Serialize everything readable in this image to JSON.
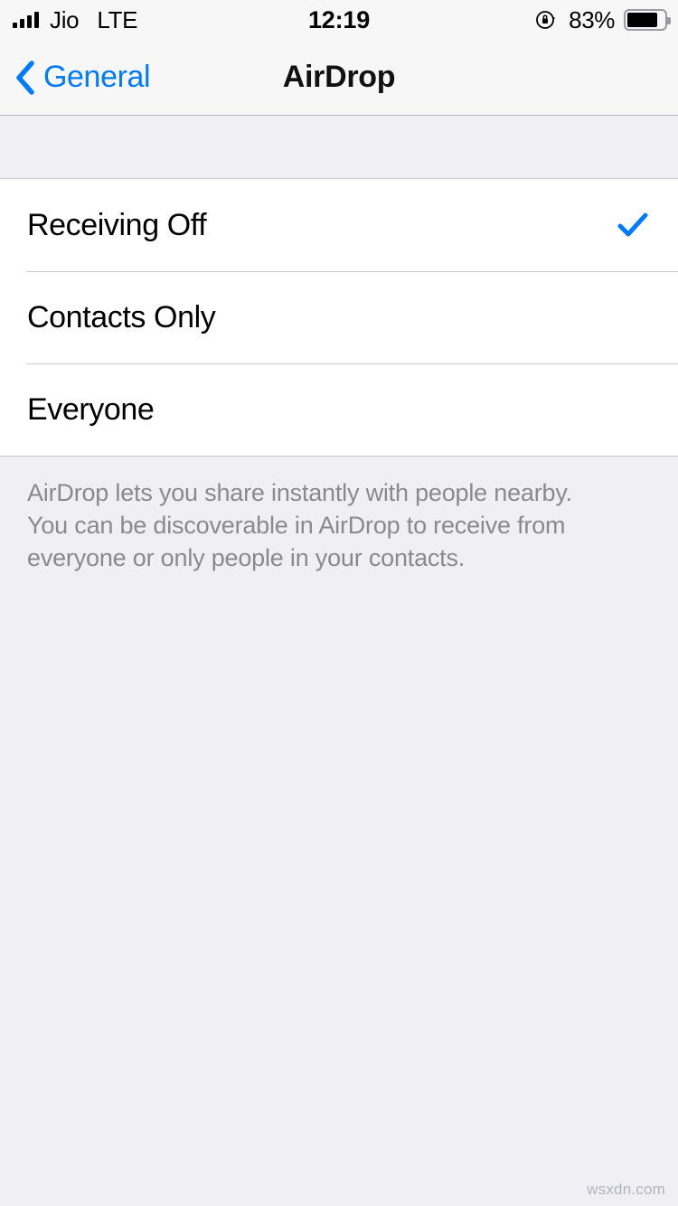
{
  "status_bar": {
    "carrier": "Jio",
    "network": "LTE",
    "time": "12:19",
    "battery_percent": "83%",
    "battery_level": 83,
    "rotation_lock_icon": "rotation-lock-icon",
    "signal_bars": 4,
    "signal_icon": "signal-bars-icon",
    "battery_icon": "battery-icon"
  },
  "nav_bar": {
    "back_label": "General",
    "back_icon": "chevron-left-icon",
    "title": "AirDrop",
    "accent_color": "#007AFF"
  },
  "options": {
    "items": [
      {
        "label": "Receiving Off",
        "selected": true
      },
      {
        "label": "Contacts Only",
        "selected": false
      },
      {
        "label": "Everyone",
        "selected": false
      }
    ],
    "check_icon": "checkmark-icon",
    "check_color": "#007AFF"
  },
  "footer": {
    "note": "AirDrop lets you share instantly with people nearby. You can be discoverable in AirDrop to receive from everyone or only people in your contacts."
  },
  "watermark": {
    "text": "wsxdn.com"
  }
}
